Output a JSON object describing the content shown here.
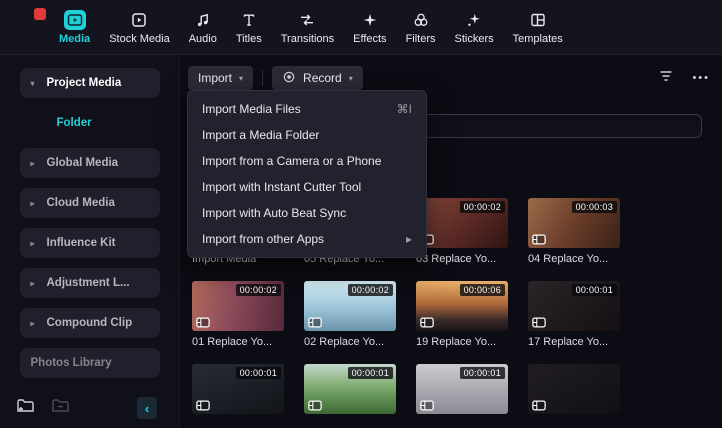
{
  "icons": {
    "chevron_down": "▾",
    "chevron_right": "▸",
    "caret_down": "▾",
    "collapse_left": "‹",
    "more": "•••"
  },
  "colors": {
    "accent": "#1fd1d6",
    "tab_active": "#1fd1d6",
    "badge_bg": "#0a0a0e"
  },
  "topbar": {
    "tabs": [
      {
        "label": "Media",
        "icon": "media-icon",
        "active": true
      },
      {
        "label": "Stock Media",
        "icon": "stock-media-icon",
        "active": false
      },
      {
        "label": "Audio",
        "icon": "audio-icon",
        "active": false
      },
      {
        "label": "Titles",
        "icon": "titles-icon",
        "active": false
      },
      {
        "label": "Transitions",
        "icon": "transitions-icon",
        "active": false
      },
      {
        "label": "Effects",
        "icon": "effects-icon",
        "active": false
      },
      {
        "label": "Filters",
        "icon": "filters-icon",
        "active": false
      },
      {
        "label": "Stickers",
        "icon": "stickers-icon",
        "active": false
      },
      {
        "label": "Templates",
        "icon": "templates-icon",
        "active": false
      }
    ]
  },
  "sidebar": {
    "items": [
      {
        "label": "Project Media",
        "expanded": true
      },
      {
        "label": "Folder",
        "selected": true
      },
      {
        "label": "Global Media"
      },
      {
        "label": "Cloud Media"
      },
      {
        "label": "Influence Kit"
      },
      {
        "label": "Adjustment L..."
      },
      {
        "label": "Compound Clip"
      },
      {
        "label": "Photos Library"
      }
    ]
  },
  "toolbar": {
    "import_label": "Import",
    "record_label": "Record",
    "search_value": "",
    "search_placeholder": ""
  },
  "menu": {
    "items": [
      {
        "label": "Import Media Files",
        "shortcut": "⌘I",
        "submenu": false
      },
      {
        "label": "Import a Media Folder",
        "shortcut": "",
        "submenu": false
      },
      {
        "label": "Import from a Camera or a Phone",
        "shortcut": "",
        "submenu": false
      },
      {
        "label": "Import with Instant Cutter Tool",
        "shortcut": "",
        "submenu": false
      },
      {
        "label": "Import with Auto Beat Sync",
        "shortcut": "",
        "submenu": false
      },
      {
        "label": "Import from other Apps",
        "shortcut": "",
        "submenu": true
      }
    ]
  },
  "grid": {
    "tiles": [
      {
        "label": "Import Media",
        "duration": "",
        "type": "import"
      },
      {
        "label": "05 Replace Yo...",
        "duration": "",
        "type": "video"
      },
      {
        "label": "03 Replace Yo...",
        "duration": "00:00:02",
        "type": "video"
      },
      {
        "label": "04 Replace Yo...",
        "duration": "00:00:03",
        "type": "video"
      },
      {
        "label": "01 Replace Yo...",
        "duration": "00:00:02",
        "type": "video"
      },
      {
        "label": "02 Replace Yo...",
        "duration": "00:00:02",
        "type": "video"
      },
      {
        "label": "19 Replace Yo...",
        "duration": "00:00:06",
        "type": "video"
      },
      {
        "label": "17 Replace Yo...",
        "duration": "00:00:01",
        "type": "video"
      },
      {
        "label": "",
        "duration": "00:00:01",
        "type": "video"
      },
      {
        "label": "",
        "duration": "00:00:01",
        "type": "video"
      },
      {
        "label": "",
        "duration": "00:00:01",
        "type": "video"
      },
      {
        "label": "",
        "duration": "",
        "type": "video"
      }
    ]
  }
}
